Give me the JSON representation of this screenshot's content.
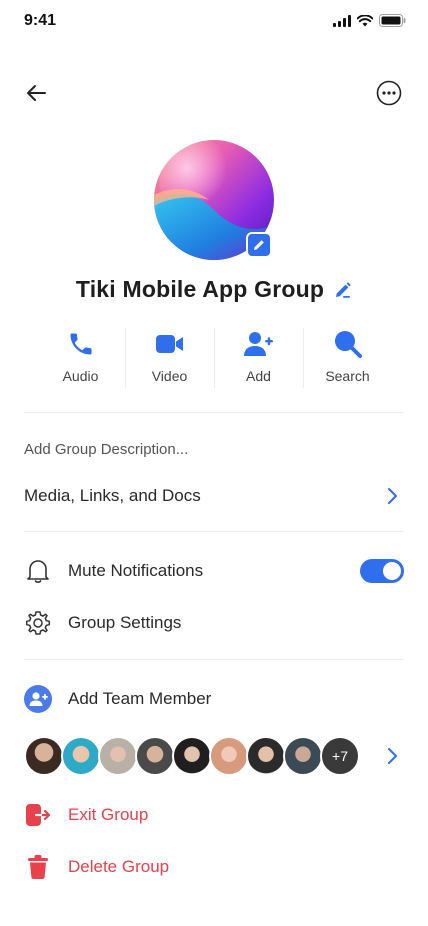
{
  "status": {
    "time": "9:41"
  },
  "header": {
    "back_icon": "arrow-left-icon",
    "more_icon": "more-horizontal-icon"
  },
  "group": {
    "name": "Tiki Mobile App Group"
  },
  "actions": [
    {
      "label": "Audio",
      "icon": "phone-icon"
    },
    {
      "label": "Video",
      "icon": "video-icon"
    },
    {
      "label": "Add",
      "icon": "add-user-icon"
    },
    {
      "label": "Search",
      "icon": "search-icon"
    }
  ],
  "description_placeholder": "Add Group Description...",
  "media_label": "Media, Links, and Docs",
  "mute_label": "Mute Notifications",
  "mute_enabled": true,
  "settings_label": "Group Settings",
  "add_member_label": "Add Team Member",
  "members_more": "+7",
  "exit_label": "Exit Group",
  "delete_label": "Delete Group",
  "colors": {
    "accent": "#2f6fed",
    "danger": "#e8414a"
  }
}
